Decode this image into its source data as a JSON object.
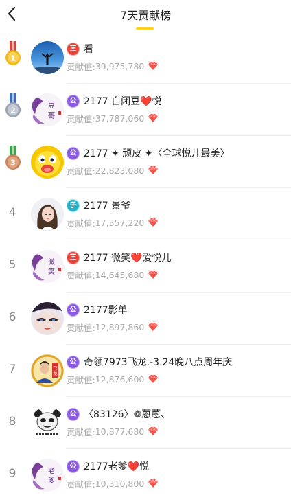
{
  "header": {
    "title": "7天贡献榜"
  },
  "contribution_label": "贡献值:",
  "colors": {
    "accent": "#ffd21f",
    "badge_king": "#e8413a",
    "badge_gong": "#8a5ae0",
    "badge_zi": "#23b4c8"
  },
  "rows": [
    {
      "rank": "1",
      "badge_text": "王",
      "badge_type": "king",
      "name": "看",
      "value": "39,975,780"
    },
    {
      "rank": "2",
      "badge_text": "公",
      "badge_type": "gong",
      "name": "2177 自闭豆❤️悦",
      "value": "37,787,060"
    },
    {
      "rank": "3",
      "badge_text": "公",
      "badge_type": "gong",
      "name": "2177 ✦ 顽皮 ✦〈全球悦儿最美〉",
      "value": "22,823,080"
    },
    {
      "rank": "4",
      "badge_text": "子",
      "badge_type": "zi",
      "name": "2177 景爷",
      "value": "17,357,220"
    },
    {
      "rank": "5",
      "badge_text": "王",
      "badge_type": "king",
      "name": "2177 微笑❤️爱悦儿",
      "value": "14,645,680"
    },
    {
      "rank": "6",
      "badge_text": "公",
      "badge_type": "gong",
      "name": "2177影单",
      "value": "12,897,860"
    },
    {
      "rank": "7",
      "badge_text": "公",
      "badge_type": "gong",
      "name": "奇领7973飞龙.-3.24晚八点周年庆",
      "value": "12,876,600"
    },
    {
      "rank": "8",
      "badge_text": "公",
      "badge_type": "gong",
      "name": "〈83126〉❁蒽蒽、",
      "value": "10,877,680"
    },
    {
      "rank": "9",
      "badge_text": "公",
      "badge_type": "gong",
      "name": "2177老爹❤️悦",
      "value": "10,310,800"
    }
  ]
}
